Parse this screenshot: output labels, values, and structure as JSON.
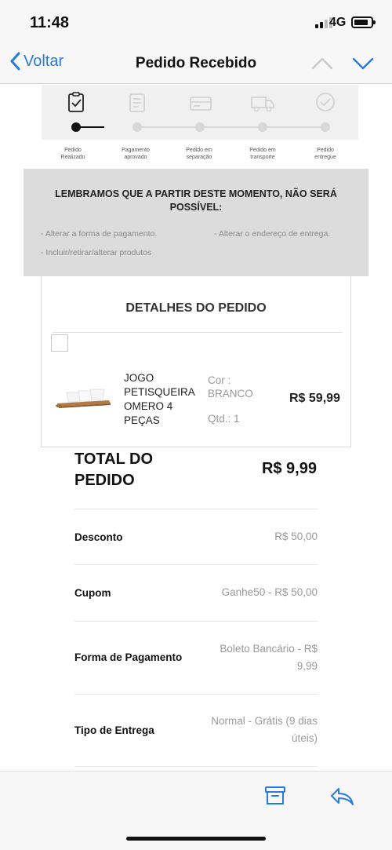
{
  "status_bar": {
    "time": "11:48",
    "network": "4G"
  },
  "nav": {
    "back_label": "Voltar",
    "title": "Pedido Recebido"
  },
  "tracker": {
    "steps": [
      {
        "label_line1": "Pedido",
        "label_line2": "Realizado",
        "state": "done"
      },
      {
        "label_line1": "Pagamento",
        "label_line2": "aprovado",
        "state": "pending"
      },
      {
        "label_line1": "Pedido em",
        "label_line2": "separação",
        "state": "pending"
      },
      {
        "label_line1": "Pedido em",
        "label_line2": "transporte",
        "state": "pending"
      },
      {
        "label_line1": "Pedido",
        "label_line2": "entregue",
        "state": "pending"
      }
    ]
  },
  "notice": {
    "title_line1": "LEMBRAMOS QUE A PARTIR DESTE MOMENTO, NÃO SERÁ",
    "title_line2": "POSSÍVEL:",
    "items": [
      "- Alterar a forma de pagamento.",
      "- Alterar o endereço de entrega.",
      "- Incluir/retirar/alterar produtos"
    ]
  },
  "details": {
    "title": "DETALHES DO PEDIDO",
    "product": {
      "name_lines": [
        "JOGO",
        "PETISQUEIRA",
        "OMERO 4",
        "PEÇAS"
      ],
      "color_label": "Cor :",
      "color_value": "BRANCO",
      "qty": "Qtd.: 1",
      "price": "R$ 59,99"
    }
  },
  "totals": {
    "total_label_line1": "TOTAL DO",
    "total_label_line2": "PEDIDO",
    "total_value": "R$ 9,99",
    "rows": [
      {
        "label": "Desconto",
        "value_line1": "R$ 50,00",
        "value_line2": ""
      },
      {
        "label": "Cupom",
        "value_line1": "Ganhe50 -  R$ 50,00",
        "value_line2": ""
      },
      {
        "label": "Forma de Pagamento",
        "value_line1": "Boleto Bancário - R$",
        "value_line2": "9,99"
      },
      {
        "label": "Tipo de Entrega",
        "value_line1": "Normal - Grátis (9 dias",
        "value_line2": "úteis)"
      }
    ]
  },
  "colors": {
    "accent": "#2a7ae2",
    "notice_bg": "#dcdcdc",
    "tracker_bg": "#f0f0f0"
  }
}
